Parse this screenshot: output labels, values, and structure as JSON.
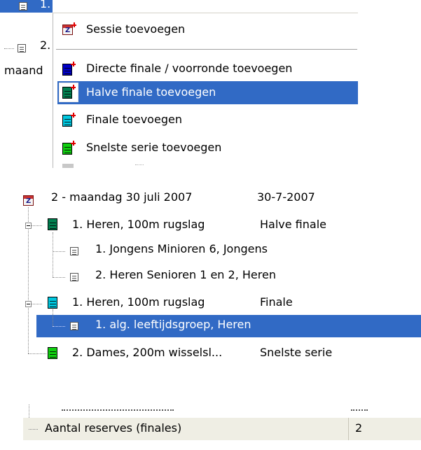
{
  "top_tree": {
    "row1_text": "1.",
    "row2_text": "2.",
    "row3_text": "maand"
  },
  "context_menu": {
    "items": [
      {
        "label": "Sessie toevoegen",
        "icon": "session-add-icon"
      },
      {
        "label": "Directe finale / voorronde toevoegen",
        "icon": "direct-final-add-icon",
        "color": "#0000c8"
      },
      {
        "label": "Halve finale toevoegen",
        "icon": "semi-final-add-icon",
        "color": "#008050",
        "selected": true
      },
      {
        "label": "Finale toevoegen",
        "icon": "final-add-icon",
        "color": "#00c8e0"
      },
      {
        "label": "Snelste serie toevoegen",
        "icon": "fastest-heat-add-icon",
        "color": "#10d010"
      }
    ]
  },
  "tree": {
    "session": {
      "label": "2 - maandag 30 juli 2007",
      "date": "30-7-2007"
    },
    "events": [
      {
        "name": "1. Heren, 100m rugslag",
        "type": "Halve finale",
        "color": "#008050",
        "groups": [
          "1. Jongens Minioren 6, Jongens",
          "2. Heren Senioren 1 en 2, Heren"
        ]
      },
      {
        "name": "1. Heren, 100m rugslag",
        "type": "Finale",
        "color": "#00c8e0",
        "groups": [
          "1. alg. leeftijdsgroep, Heren"
        ]
      },
      {
        "name": "2. Dames, 200m wisselsl...",
        "type": "Snelste serie",
        "color": "#10d010",
        "groups": []
      }
    ]
  },
  "properties": {
    "row_label": "Aantal reserves (finales)",
    "row_value": "2"
  },
  "colors": {
    "selection": "#316ac5",
    "grid_row": "#efeee4"
  }
}
